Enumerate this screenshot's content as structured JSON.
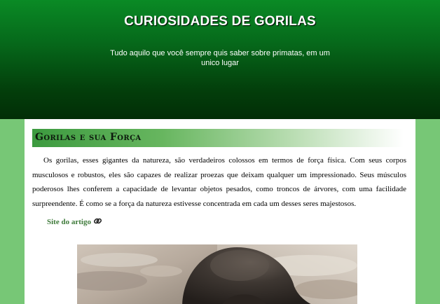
{
  "header": {
    "title": "CURIOSIDADES DE GORILAS",
    "subtitle": "Tudo aquilo que você sempre quis saber sobre primatas, em um unico lugar"
  },
  "post": {
    "title": "Gorilas e sua Força",
    "body": "Os gorilas, esses gigantes da natureza, são verdadeiros colossos em termos de força física. Com seus corpos musculosos e robustos, eles são capazes de realizar proezas que deixam qualquer um impressionado. Seus músculos poderosos lhes conferem a capacidade de levantar objetos pesados, como troncos de árvores, com uma facilidade surpreendente. É como se a força da natureza estivesse concentrada em cada um desses seres majestosos.",
    "source_link": "Site do artigo",
    "link_icon": "paperclip-icon"
  },
  "colors": {
    "header_green": "#066a1b",
    "page_background": "#77c776",
    "link_green": "#3e7a3a"
  }
}
